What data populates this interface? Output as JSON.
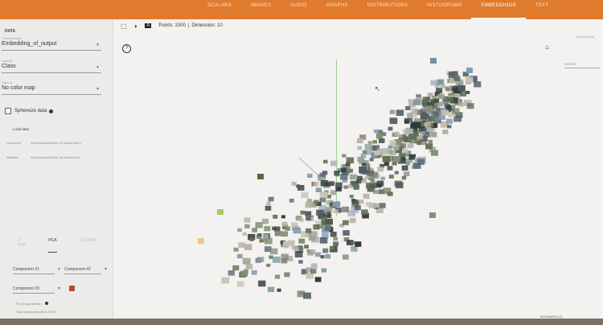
{
  "nav": {
    "tabs": [
      "SCALARS",
      "IMAGES",
      "AUDIO",
      "GRAPHS",
      "DISTRIBUTIONS",
      "HISTOGRAMS",
      "EMBEDDINGS",
      "TEXT"
    ],
    "active_tab": "EMBEDDINGS"
  },
  "sidebar": {
    "title": "DATA",
    "tensor_label": "7 tensors found",
    "tensor_value": "Embedding_of_output",
    "label_by_label": "Label by",
    "label_by_value": "Class",
    "color_by_label": "Color by",
    "color_by_value": "No color map",
    "sphereize_label": "Sphereize data",
    "load_data": "Load data",
    "checkpoint_key": "Checkpoint:",
    "checkpoint_value": "/tmp/tensorboard/cifar-10/ model2.ckpt-1",
    "metadata_key": "Metadata:",
    "metadata_value": "/tmp/tensorboard/cifar-10/ metadata.tsv"
  },
  "projection": {
    "tabs": [
      "T-SNE",
      "PCA",
      "CUSTOM"
    ],
    "active": "PCA",
    "component_1": "Component #1",
    "component_2": "Component #2",
    "component_3": "Component #3",
    "approx_note": "PCA is approximate.",
    "variance_note": "Total variance described: 40.3%"
  },
  "toolbar": {
    "points": "Points: 1000",
    "dimension": "Dimension: 10",
    "icons": [
      "select-icon",
      "night-mode-icon",
      "label-icon"
    ]
  },
  "right": {
    "show_all": "Show All Data",
    "search_placeholder": "Search",
    "bookmarks": "BOOKMARKS (0)"
  },
  "colors": {
    "topbar": "#e07a2c",
    "accent": "#c0462b",
    "axis_green": "#9fd48a"
  }
}
